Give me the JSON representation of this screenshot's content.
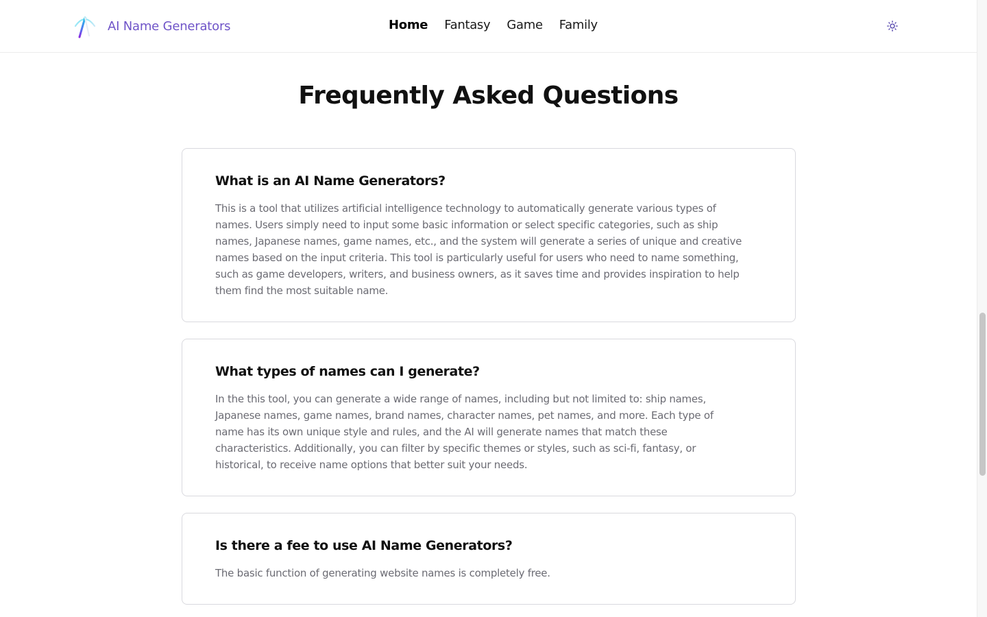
{
  "header": {
    "brand_name": "AI Name Generators",
    "nav": [
      {
        "label": "Home",
        "active": true
      },
      {
        "label": "Fantasy",
        "active": false
      },
      {
        "label": "Game",
        "active": false
      },
      {
        "label": "Family",
        "active": false
      }
    ],
    "theme_icon": "sun-icon"
  },
  "main": {
    "title": "Frequently Asked Questions",
    "faqs": [
      {
        "question": "What is an AI Name Generators?",
        "answer": "This is a tool that utilizes artificial intelligence technology to automatically generate various types of names. Users simply need to input some basic information or select specific categories, such as ship names, Japanese names, game names, etc., and the system will generate a series of unique and creative names based on the input criteria. This tool is particularly useful for users who need to name something, such as game developers, writers, and business owners, as it saves time and provides inspiration to help them find the most suitable name."
      },
      {
        "question": "What types of names can I generate?",
        "answer": "In the this tool, you can generate a wide range of names, including but not limited to: ship names, Japanese names, game names, brand names, character names, pet names, and more. Each type of name has its own unique style and rules, and the AI will generate names that match these characteristics. Additionally, you can filter by specific themes or styles, such as sci-fi, fantasy, or historical, to receive name options that better suit your needs."
      },
      {
        "question": "Is there a fee to use AI Name Generators?",
        "answer": "The basic function of generating website names is completely free."
      }
    ]
  },
  "colors": {
    "brand": "#6f54c8",
    "answer_text": "#6b6b73",
    "card_border": "#d9d9de"
  }
}
